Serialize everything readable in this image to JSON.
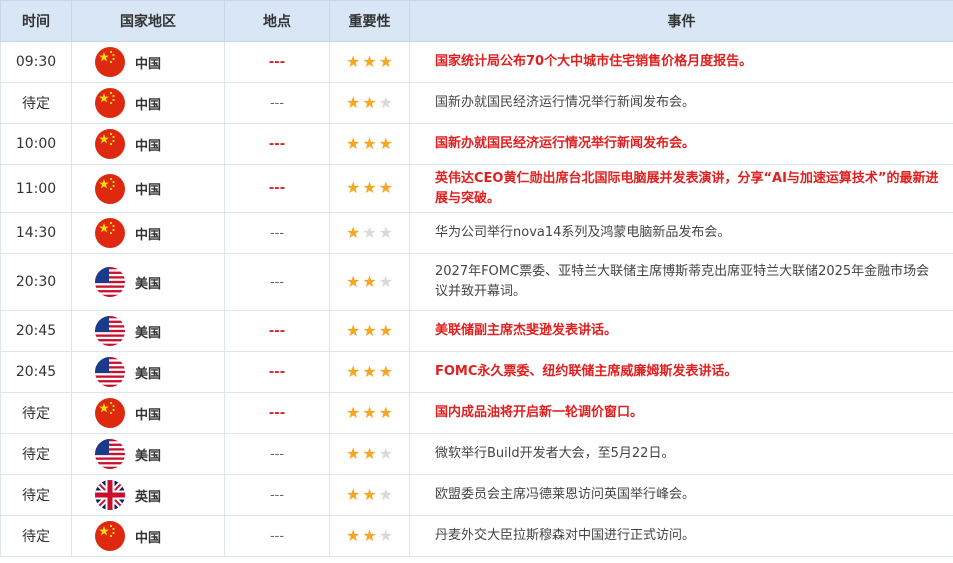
{
  "header": [
    "时间",
    "国家地区",
    "地点",
    "重要性",
    "事件"
  ],
  "colors": {
    "highlight": "#e02020",
    "star_on": "#f5a623",
    "star_off": "#d9d9d9",
    "header_bg": "#d8e6f5"
  },
  "star_glyph": "★",
  "rows": [
    {
      "time": "09:30",
      "flag": "cn",
      "country": "中国",
      "location": "---",
      "stars": 3,
      "event": "国家统计局公布70个大中城市住宅销售价格月度报告。",
      "highlight": true
    },
    {
      "time": "待定",
      "flag": "cn",
      "country": "中国",
      "location": "---",
      "stars": 2,
      "event": "国新办就国民经济运行情况举行新闻发布会。",
      "highlight": false
    },
    {
      "time": "10:00",
      "flag": "cn",
      "country": "中国",
      "location": "---",
      "stars": 3,
      "event": "国新办就国民经济运行情况举行新闻发布会。",
      "highlight": true
    },
    {
      "time": "11:00",
      "flag": "cn",
      "country": "中国",
      "location": "---",
      "stars": 3,
      "event": "英伟达CEO黄仁勋出席台北国际电脑展并发表演讲，分享“AI与加速运算技术”的最新进展与突破。",
      "highlight": true
    },
    {
      "time": "14:30",
      "flag": "cn",
      "country": "中国",
      "location": "---",
      "stars": 1,
      "event": "华为公司举行nova14系列及鸿蒙电脑新品发布会。",
      "highlight": false
    },
    {
      "time": "20:30",
      "flag": "us",
      "country": "美国",
      "location": "---",
      "stars": 2,
      "event": "2027年FOMC票委、亚特兰大联储主席博斯蒂克出席亚特兰大联储2025年金融市场会议并致开幕词。",
      "highlight": false
    },
    {
      "time": "20:45",
      "flag": "us",
      "country": "美国",
      "location": "---",
      "stars": 3,
      "event": "美联储副主席杰斐逊发表讲话。",
      "highlight": true
    },
    {
      "time": "20:45",
      "flag": "us",
      "country": "美国",
      "location": "---",
      "stars": 3,
      "event": "FOMC永久票委、纽约联储主席威廉姆斯发表讲话。",
      "highlight": true
    },
    {
      "time": "待定",
      "flag": "cn",
      "country": "中国",
      "location": "---",
      "stars": 3,
      "event": "国内成品油将开启新一轮调价窗口。",
      "highlight": true
    },
    {
      "time": "待定",
      "flag": "us",
      "country": "美国",
      "location": "---",
      "stars": 2,
      "event": "微软举行Build开发者大会，至5月22日。",
      "highlight": false
    },
    {
      "time": "待定",
      "flag": "uk",
      "country": "英国",
      "location": "---",
      "stars": 2,
      "event": "欧盟委员会主席冯德莱恩访问英国举行峰会。",
      "highlight": false
    },
    {
      "time": "待定",
      "flag": "cn",
      "country": "中国",
      "location": "---",
      "stars": 2,
      "event": "丹麦外交大臣拉斯穆森对中国进行正式访问。",
      "highlight": false
    }
  ]
}
